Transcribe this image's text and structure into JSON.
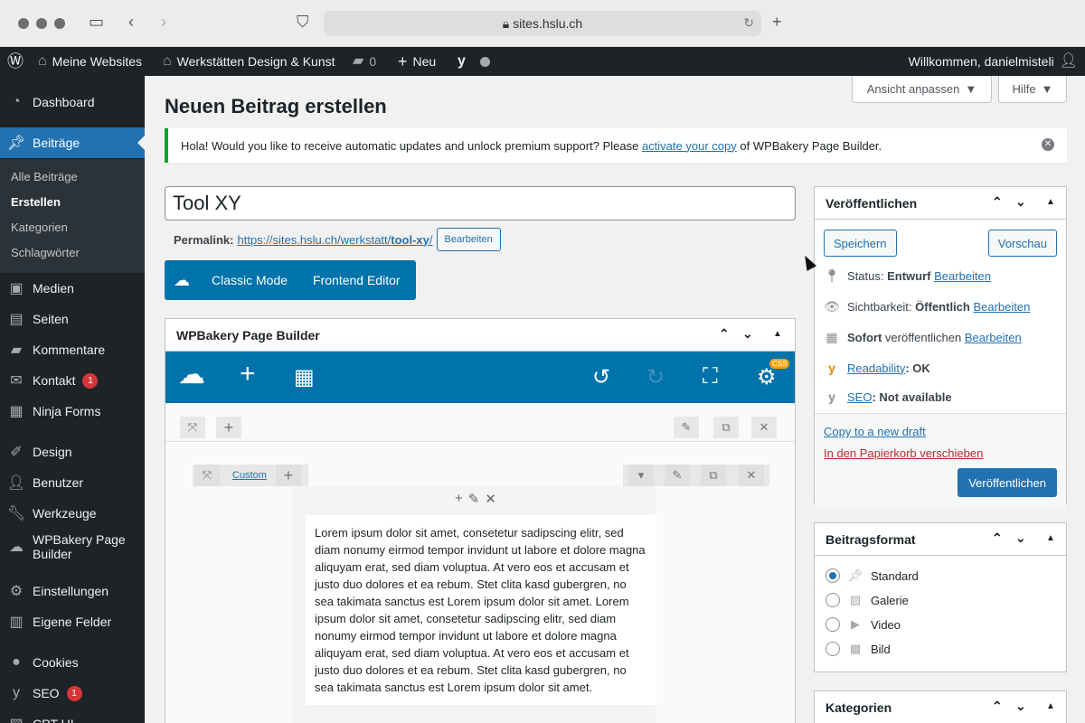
{
  "browser": {
    "url": "sites.hslu.ch"
  },
  "adminbar": {
    "my_sites": "Meine Websites",
    "site_name": "Werkstätten Design & Kunst",
    "comments_count": "0",
    "new_label": "Neu",
    "greeting": "Willkommen, danielmisteli"
  },
  "sidebar": {
    "items": [
      {
        "label": "Dashboard",
        "icon": "dashboard-icon"
      },
      {
        "label": "Beiträge",
        "icon": "pin-icon"
      },
      {
        "label": "Medien",
        "icon": "media-icon"
      },
      {
        "label": "Seiten",
        "icon": "pages-icon"
      },
      {
        "label": "Kommentare",
        "icon": "comment-icon"
      },
      {
        "label": "Kontakt",
        "icon": "mail-icon",
        "badge": "1"
      },
      {
        "label": "Ninja Forms",
        "icon": "forms-icon"
      },
      {
        "label": "Design",
        "icon": "brush-icon"
      },
      {
        "label": "Benutzer",
        "icon": "user-icon"
      },
      {
        "label": "Werkzeuge",
        "icon": "wrench-icon"
      },
      {
        "label": "WPBakery Page",
        "label2": "Builder",
        "icon": "cloud-icon"
      },
      {
        "label": "Einstellungen",
        "icon": "settings-icon"
      },
      {
        "label": "Eigene Felder",
        "icon": "fields-icon"
      },
      {
        "label": "Cookies",
        "icon": "cookie-icon"
      },
      {
        "label": "SEO",
        "icon": "yoast-icon",
        "badge": "1"
      },
      {
        "label": "CPT UI",
        "icon": "cpt-icon"
      }
    ],
    "submenu": [
      "Alle Beiträge",
      "Erstellen",
      "Kategorien",
      "Schlagwörter"
    ]
  },
  "screen_options": "Ansicht anpassen",
  "help": "Hilfe",
  "page_title": "Neuen Beitrag erstellen",
  "notice": {
    "before": "Hola! Would you like to receive automatic updates and unlock premium support? Please",
    "link": "activate your copy",
    "after": "of WPBakery Page Builder."
  },
  "post_title": "Tool XY",
  "permalink": {
    "label": "Permalink:",
    "url_base": "https://sites.hslu.ch/werkstatt/",
    "slug": "tool-xy",
    "slash": "/",
    "edit": "Bearbeiten"
  },
  "modes": {
    "classic": "Classic Mode",
    "frontend": "Frontend Editor"
  },
  "wpbakery": {
    "title": "WPBakery Page Builder",
    "css_badge": "CSS",
    "custom_label": "Custom",
    "text": "Lorem ipsum dolor sit amet, consetetur sadipscing elitr, sed diam nonumy eirmod tempor invidunt ut labore et dolore magna aliquyam erat, sed diam voluptua. At vero eos et accusam et justo duo dolores et ea rebum. Stet clita kasd gubergren, no sea takimata sanctus est Lorem ipsum dolor sit amet. Lorem ipsum dolor sit amet, consetetur sadipscing elitr, sed diam nonumy eirmod tempor invidunt ut labore et dolore magna aliquyam erat, sed diam voluptua. At vero eos et accusam et justo duo dolores et ea rebum. Stet clita kasd gubergren, no sea takimata sanctus est Lorem ipsum dolor sit amet."
  },
  "publish": {
    "title": "Veröffentlichen",
    "save": "Speichern",
    "preview": "Vorschau",
    "status_label": "Status:",
    "status_value": "Entwurf",
    "visibility_label": "Sichtbarkeit:",
    "visibility_value": "Öffentlich",
    "schedule_bold": "Sofort",
    "schedule_rest": "veröffentlichen",
    "edit": "Bearbeiten",
    "readability_link": "Readability",
    "readability_value": ": OK",
    "seo_link": "SEO",
    "seo_value": ": Not available",
    "copy_draft": "Copy to a new draft",
    "trash": "In den Papierkorb verschieben",
    "publish_button": "Veröffentlichen"
  },
  "format": {
    "title": "Beitragsformat",
    "options": [
      {
        "label": "Standard",
        "icon": "pin-icon",
        "checked": true
      },
      {
        "label": "Galerie",
        "icon": "gallery-icon",
        "checked": false
      },
      {
        "label": "Video",
        "icon": "video-icon",
        "checked": false
      },
      {
        "label": "Bild",
        "icon": "image-icon",
        "checked": false
      }
    ]
  },
  "categories": {
    "title": "Kategorien"
  },
  "colors": {
    "accent": "#2271b1",
    "sidebar": "#1d2327",
    "wpbakery": "#0073aa",
    "notice": "#00a32a"
  }
}
